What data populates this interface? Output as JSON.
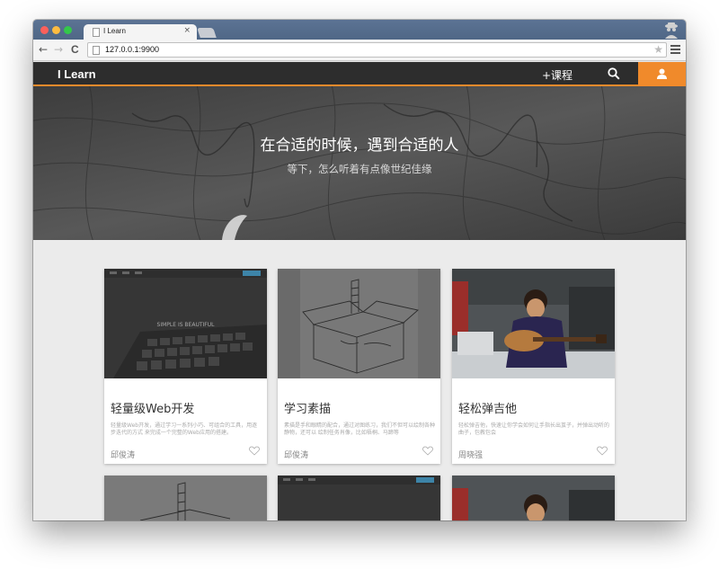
{
  "browser": {
    "tab_title": "I Learn",
    "tab_close": "×",
    "url": "127.0.0.1:9900",
    "back": "←",
    "forward": "→",
    "reload": "C",
    "star": "★"
  },
  "navbar": {
    "brand": "I Learn",
    "course_link": "+课程",
    "accent_color": "#f08a2b"
  },
  "hero": {
    "title": "在合适的时候，遇到合适的人",
    "subtitle": "等下，怎么听着有点像世纪佳缘"
  },
  "thumb_text": {
    "web_headline": "SIMPLE IS BEAUTIFUL"
  },
  "courses": [
    {
      "title": "轻量级Web开发",
      "description": "轻量级Web开发，通过学习一系列小巧、可组合的工具，用逐步迭代的方式 来完成一个完整的Web应用的搭建。",
      "author": "邱俊涛"
    },
    {
      "title": "学习素描",
      "description": "素描是手和眼睛的配合，通过对图练习，我们不但可以绘制各种静物，还可以 绘制任务肖像，比如梧桐、马蹄等",
      "author": "邱俊涛"
    },
    {
      "title": "轻松弹吉他",
      "description": "轻松弹吉他，快速让你学会如何让手指长出茧子，并弹出动听的曲子，包教包会",
      "author": "周晓强"
    }
  ]
}
